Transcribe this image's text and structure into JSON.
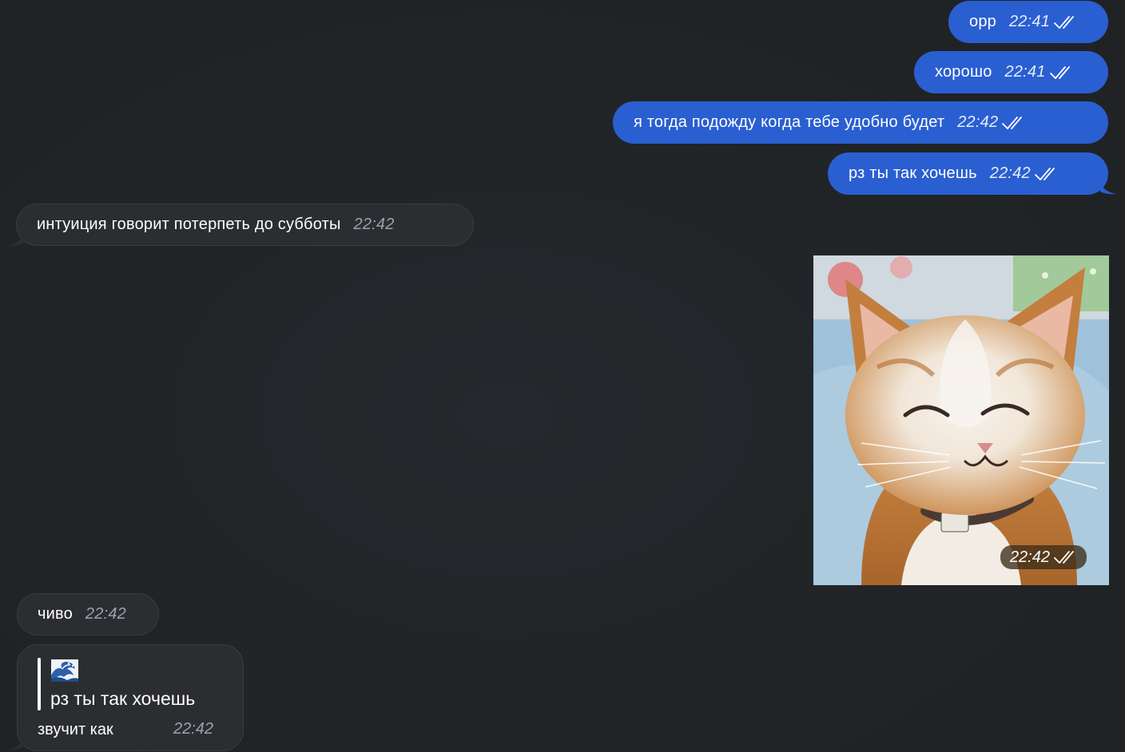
{
  "messages": {
    "out1": {
      "text": "орр",
      "time": "22:41"
    },
    "out2": {
      "text": "хорошо",
      "time": "22:41"
    },
    "out3": {
      "text": "я тогда подожду когда тебе удобно будет",
      "time": "22:42"
    },
    "out4": {
      "text": "рз ты так хочешь",
      "time": "22:42"
    },
    "in1": {
      "text": "интуиция говорит потерпеть до субботы",
      "time": "22:42"
    },
    "image": {
      "time": "22:42",
      "description_icon": "smiling-cat-gif"
    },
    "in2": {
      "text": "чиво",
      "time": "22:42"
    },
    "in3": {
      "quote_emoji": "🌊",
      "quote_text": "рз ты так хочешь",
      "text": "звучит как",
      "time": "22:42"
    }
  },
  "colors": {
    "background": "#212427",
    "outgoing_bubble": "#2a5fd1",
    "incoming_bubble": "#2b2d31",
    "incoming_time": "#9aa3b0"
  },
  "icons": {
    "read_receipt": "double-check-icon"
  }
}
